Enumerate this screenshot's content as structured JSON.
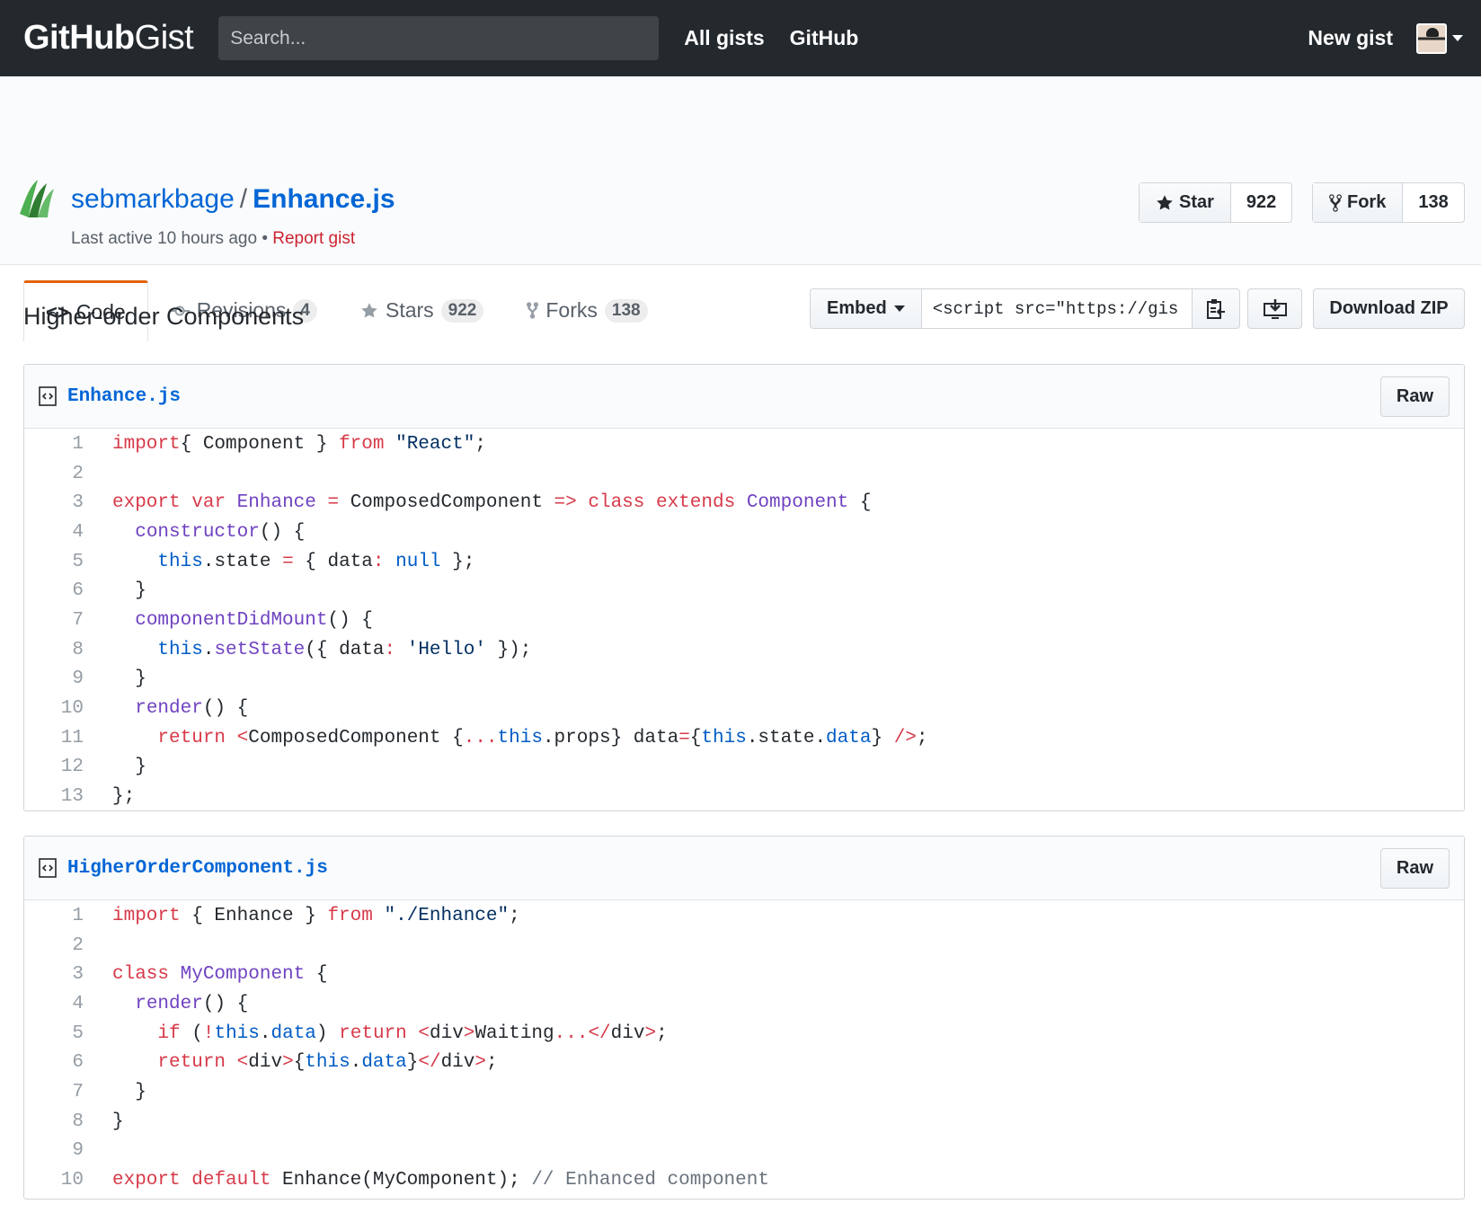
{
  "header": {
    "logo_bold": "GitHub",
    "logo_light": "Gist",
    "search_placeholder": "Search...",
    "nav": [
      "All gists",
      "GitHub"
    ],
    "new_gist": "New gist"
  },
  "gist": {
    "owner": "sebmarkbage",
    "separator": "/",
    "name": "Enhance.js",
    "last_active": "Last active 10 hours ago",
    "bullet": "•",
    "report": "Report gist",
    "star_label": "Star",
    "star_count": "922",
    "fork_label": "Fork",
    "fork_count": "138"
  },
  "tabs": {
    "code": "Code",
    "revisions": "Revisions",
    "revisions_count": "4",
    "stars": "Stars",
    "stars_count": "922",
    "forks": "Forks",
    "forks_count": "138"
  },
  "actions": {
    "embed": "Embed",
    "embed_value": "<script src=\"https://gis",
    "download_zip": "Download ZIP"
  },
  "description": "Higher-order Components",
  "files": [
    {
      "name": "Enhance.js",
      "raw": "Raw",
      "lines": [
        "1",
        "2",
        "3",
        "4",
        "5",
        "6",
        "7",
        "8",
        "9",
        "10",
        "11",
        "12",
        "13"
      ]
    },
    {
      "name": "HigherOrderComponent.js",
      "raw": "Raw",
      "lines": [
        "1",
        "2",
        "3",
        "4",
        "5",
        "6",
        "7",
        "8",
        "9",
        "10"
      ]
    }
  ],
  "code_file1": [
    [
      [
        "k",
        "import"
      ],
      [
        "",
        "{ Component } "
      ],
      [
        "k",
        "from"
      ],
      [
        "",
        " "
      ],
      [
        "s",
        "\"React\""
      ],
      [
        "",
        ";"
      ]
    ],
    [],
    [
      [
        "k",
        "export"
      ],
      [
        "",
        " "
      ],
      [
        "k",
        "var"
      ],
      [
        "",
        " "
      ],
      [
        "e",
        "Enhance"
      ],
      [
        "",
        " "
      ],
      [
        "k",
        "="
      ],
      [
        "",
        " ComposedComponent "
      ],
      [
        "k",
        "=>"
      ],
      [
        "",
        " "
      ],
      [
        "k",
        "class"
      ],
      [
        "",
        " "
      ],
      [
        "k",
        "extends"
      ],
      [
        "",
        " "
      ],
      [
        "e",
        "Component"
      ],
      [
        "",
        " {"
      ]
    ],
    [
      [
        "",
        "  "
      ],
      [
        "e",
        "constructor"
      ],
      [
        "",
        "() {"
      ]
    ],
    [
      [
        "",
        "    "
      ],
      [
        "c1",
        "this"
      ],
      [
        "",
        ".state "
      ],
      [
        "k",
        "="
      ],
      [
        "",
        " { data"
      ],
      [
        "k",
        ":"
      ],
      [
        "",
        " "
      ],
      [
        "c1",
        "null"
      ],
      [
        "",
        " };"
      ]
    ],
    [
      [
        "",
        "  }"
      ]
    ],
    [
      [
        "",
        "  "
      ],
      [
        "e",
        "componentDidMount"
      ],
      [
        "",
        "() {"
      ]
    ],
    [
      [
        "",
        "    "
      ],
      [
        "c1",
        "this"
      ],
      [
        "",
        "."
      ],
      [
        "e",
        "setState"
      ],
      [
        "",
        "({ data"
      ],
      [
        "k",
        ":"
      ],
      [
        "",
        " "
      ],
      [
        "s",
        "'Hello'"
      ],
      [
        "",
        " });"
      ]
    ],
    [
      [
        "",
        "  }"
      ]
    ],
    [
      [
        "",
        "  "
      ],
      [
        "e",
        "render"
      ],
      [
        "",
        "() {"
      ]
    ],
    [
      [
        "",
        "    "
      ],
      [
        "k",
        "return"
      ],
      [
        "",
        " "
      ],
      [
        "k",
        "<"
      ],
      [
        "",
        "ComposedComponent {"
      ],
      [
        "k",
        "..."
      ],
      [
        "c1",
        "this"
      ],
      [
        "",
        ".props} data"
      ],
      [
        "k",
        "="
      ],
      [
        "",
        "{"
      ],
      [
        "c1",
        "this"
      ],
      [
        "",
        ".state."
      ],
      [
        "c1",
        "data"
      ],
      [
        "",
        "} "
      ],
      [
        "k",
        "/>"
      ],
      [
        "",
        ";"
      ]
    ],
    [
      [
        "",
        "  }"
      ]
    ],
    [
      [
        "",
        "};"
      ]
    ]
  ],
  "code_file2": [
    [
      [
        "k",
        "import"
      ],
      [
        "",
        " { Enhance } "
      ],
      [
        "k",
        "from"
      ],
      [
        "",
        " "
      ],
      [
        "s",
        "\"./Enhance\""
      ],
      [
        "",
        ";"
      ]
    ],
    [],
    [
      [
        "k",
        "class"
      ],
      [
        "",
        " "
      ],
      [
        "e",
        "MyComponent"
      ],
      [
        "",
        " {"
      ]
    ],
    [
      [
        "",
        "  "
      ],
      [
        "e",
        "render"
      ],
      [
        "",
        "() {"
      ]
    ],
    [
      [
        "",
        "    "
      ],
      [
        "k",
        "if"
      ],
      [
        "",
        " ("
      ],
      [
        "k",
        "!"
      ],
      [
        "c1",
        "this"
      ],
      [
        "",
        "."
      ],
      [
        "c1",
        "data"
      ],
      [
        "",
        ") "
      ],
      [
        "k",
        "return"
      ],
      [
        "",
        " "
      ],
      [
        "k",
        "<"
      ],
      [
        "",
        "div"
      ],
      [
        "k",
        ">"
      ],
      [
        "",
        "Waiting"
      ],
      [
        "k",
        "..."
      ],
      [
        "k",
        "</"
      ],
      [
        "",
        "div"
      ],
      [
        "k",
        ">"
      ],
      [
        "",
        ";"
      ]
    ],
    [
      [
        "",
        "    "
      ],
      [
        "k",
        "return"
      ],
      [
        "",
        " "
      ],
      [
        "k",
        "<"
      ],
      [
        "",
        "div"
      ],
      [
        "k",
        ">"
      ],
      [
        "",
        "{"
      ],
      [
        "c1",
        "this"
      ],
      [
        "",
        "."
      ],
      [
        "c1",
        "data"
      ],
      [
        "",
        "}"
      ],
      [
        "k",
        "</"
      ],
      [
        "",
        "div"
      ],
      [
        "k",
        ">"
      ],
      [
        "",
        ";"
      ]
    ],
    [
      [
        "",
        "  }"
      ]
    ],
    [
      [
        "",
        "}"
      ]
    ],
    [],
    [
      [
        "k",
        "export"
      ],
      [
        "",
        " "
      ],
      [
        "k",
        "default"
      ],
      [
        "",
        " Enhance(MyComponent); "
      ],
      [
        "cm",
        "// Enhanced component"
      ]
    ]
  ]
}
